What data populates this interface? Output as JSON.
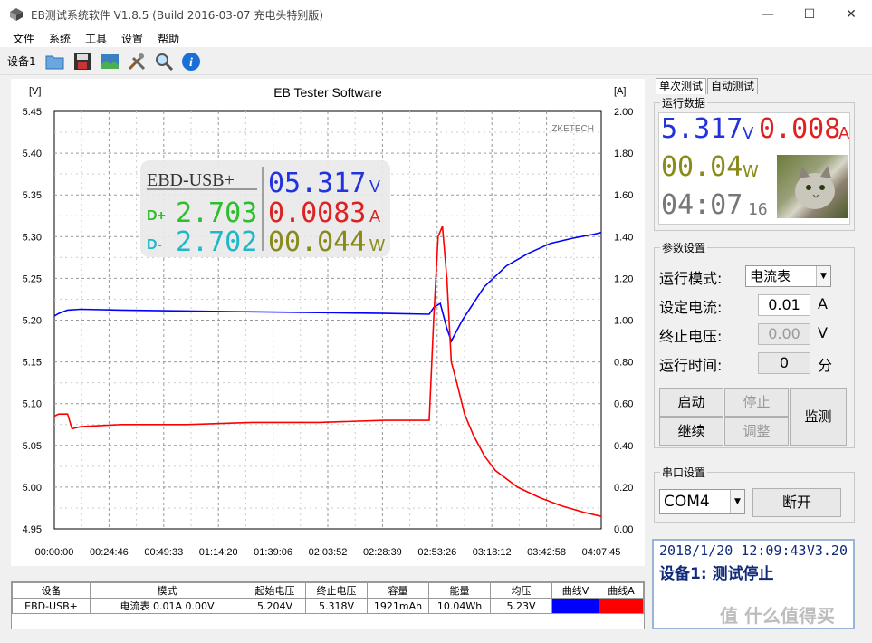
{
  "window": {
    "title": "EB测试系统软件 V1.8.5 (Build 2016-03-07 充电头特别版)"
  },
  "menu": [
    "文件",
    "系统",
    "工具",
    "设置",
    "帮助"
  ],
  "toolbar": {
    "device": "设备1",
    "icons": [
      "folder-icon",
      "save-icon",
      "image-icon",
      "tools-icon",
      "search-icon",
      "info-icon"
    ]
  },
  "chart_data": {
    "type": "line",
    "title": "EB Tester Software",
    "brand": "ZKETECH",
    "ylabel_left": "[V]",
    "ylabel_right": "[A]",
    "ylim_left": [
      4.95,
      5.45
    ],
    "ylim_right": [
      0.0,
      2.0
    ],
    "yticks_left": [
      "5.45",
      "5.40",
      "5.35",
      "5.30",
      "5.25",
      "5.20",
      "5.15",
      "5.10",
      "5.05",
      "5.00",
      "4.95"
    ],
    "yticks_right": [
      "2.00",
      "1.80",
      "1.60",
      "1.40",
      "1.20",
      "1.00",
      "0.80",
      "0.60",
      "0.40",
      "0.20",
      "0.00"
    ],
    "xticks": [
      "00:00:00",
      "00:24:46",
      "00:49:33",
      "01:14:20",
      "01:39:06",
      "02:03:52",
      "02:28:39",
      "02:53:26",
      "03:18:12",
      "03:42:58",
      "04:07:45"
    ],
    "series": [
      {
        "name": "曲线V",
        "color": "#0000ff",
        "x": [
          0,
          2,
          6,
          12,
          30,
          60,
          90,
          120,
          150,
          170,
          172,
          175,
          178,
          180,
          185,
          195,
          205,
          215,
          225,
          235,
          245,
          248
        ],
        "y": [
          5.205,
          5.208,
          5.212,
          5.213,
          5.212,
          5.211,
          5.21,
          5.209,
          5.208,
          5.207,
          5.215,
          5.22,
          5.19,
          5.175,
          5.2,
          5.24,
          5.265,
          5.28,
          5.292,
          5.298,
          5.303,
          5.305
        ]
      },
      {
        "name": "曲线A",
        "color": "#ff0000",
        "x": [
          0,
          2,
          6,
          8,
          12,
          30,
          60,
          90,
          120,
          150,
          170,
          172,
          174,
          176,
          178,
          180,
          183,
          186,
          190,
          195,
          200,
          210,
          220,
          230,
          240,
          248
        ],
        "y": [
          0.54,
          0.55,
          0.55,
          0.48,
          0.49,
          0.5,
          0.5,
          0.51,
          0.51,
          0.52,
          0.52,
          1.0,
          1.4,
          1.45,
          1.2,
          0.8,
          0.68,
          0.55,
          0.45,
          0.35,
          0.28,
          0.2,
          0.15,
          0.11,
          0.08,
          0.06
        ]
      }
    ]
  },
  "overlay": {
    "label": "EBD-USB+",
    "voltage": "05.317",
    "voltage_unit": "V",
    "current": "0.0083",
    "current_unit": "A",
    "dplus_label": "D+",
    "dplus": "2.703",
    "dminus_label": "D-",
    "dminus": "2.702",
    "power": "00.044",
    "power_unit": "W"
  },
  "tabs": [
    "单次测试",
    "自动测试"
  ],
  "run_data": {
    "title": "运行数据",
    "voltage": "5.317",
    "voltage_unit": "V",
    "current": "0.008",
    "current_unit": "A",
    "power": "00.04",
    "power_unit": "W",
    "time": "04:07",
    "time_sec": "16"
  },
  "params": {
    "title": "参数设置",
    "mode_label": "运行模式:",
    "mode_value": "电流表",
    "current_label": "设定电流:",
    "current_value": "0.01",
    "current_unit": "A",
    "stopv_label": "终止电压:",
    "stopv_value": "0.00",
    "stopv_unit": "V",
    "time_label": "运行时间:",
    "time_value": "0",
    "time_unit": "分",
    "btn_start": "启动",
    "btn_stop": "停止",
    "btn_monitor": "监测",
    "btn_continue": "继续",
    "btn_adjust": "调整"
  },
  "serial": {
    "title": "串口设置",
    "port": "COM4",
    "disconnect": "断开"
  },
  "status": {
    "datetime": "2018/1/20 12:09:43",
    "version": "V3.20",
    "message": "设备1: 测试停止"
  },
  "table": {
    "headers": [
      "设备",
      "模式",
      "起始电压",
      "终止电压",
      "容量",
      "能量",
      "均压",
      "曲线V",
      "曲线A"
    ],
    "row": [
      "EBD-USB+",
      "电流表  0.01A  0.00V",
      "5.204V",
      "5.318V",
      "1921mAh",
      "10.04Wh",
      "5.23V",
      "",
      ""
    ]
  },
  "watermark": "值 什么值得买"
}
